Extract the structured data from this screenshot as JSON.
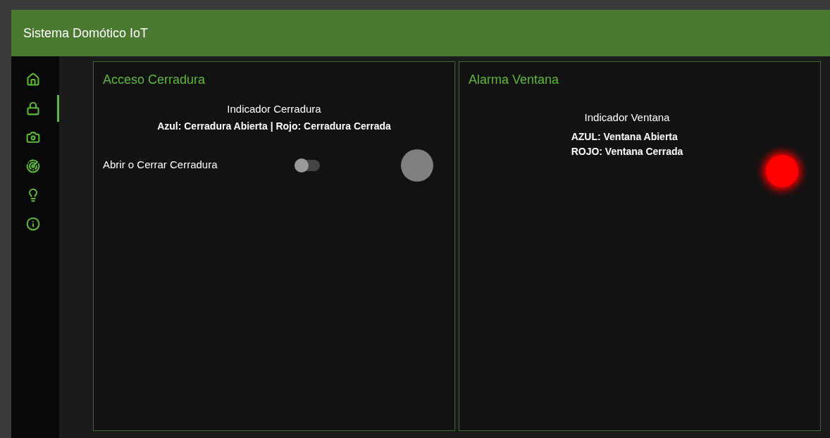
{
  "header": {
    "title": "Sistema Domótico IoT"
  },
  "sidebar": {
    "items": [
      {
        "kind": "home",
        "selected": false
      },
      {
        "kind": "lock",
        "selected": true
      },
      {
        "kind": "camera",
        "selected": false
      },
      {
        "kind": "radar",
        "selected": false
      },
      {
        "kind": "bulb",
        "selected": false
      },
      {
        "kind": "info",
        "selected": false
      }
    ]
  },
  "cards": [
    {
      "kind": "lock",
      "title": "Acceso Cerradura",
      "indicator_label": "Indicador Cerradura",
      "legend": [
        "Azul: Cerradura Abierta | Rojo: Cerradura Cerrada"
      ],
      "switch_label": "Abrir o Cerrar Cerradura",
      "switch_on": false,
      "color": "#808080"
    },
    {
      "kind": "window",
      "title": "Alarma Ventana",
      "indicator_label": "Indicador Ventana",
      "legend": [
        "AZUL: Ventana Abierta",
        "ROJO: Ventana Cerrada"
      ],
      "color": "#ff0000"
    }
  ]
}
